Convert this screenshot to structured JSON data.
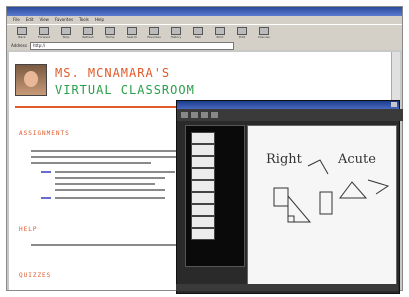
{
  "browser": {
    "menu": [
      "File",
      "Edit",
      "View",
      "Favorites",
      "Tools",
      "Help"
    ],
    "toolbar": [
      "Back",
      "Forward",
      "Stop",
      "Refresh",
      "Home",
      "Search",
      "Favorites",
      "History",
      "Mail",
      "Print",
      "Edit",
      "Discuss"
    ],
    "address_label": "Address",
    "address_value": "http://"
  },
  "page": {
    "title_line1": "MS. MCNAMARA'S",
    "title_line2": "VIRTUAL CLASSROOM",
    "section_assignments": "ASSIGNMENTS",
    "section_help": "HELP",
    "section_quizzes": "QUIZZES"
  },
  "whiteboard": {
    "handwriting_1": "Right",
    "handwriting_2": "Acute"
  },
  "colors": {
    "accent_orange": "#e05a2a",
    "accent_green": "#2aa04a"
  }
}
